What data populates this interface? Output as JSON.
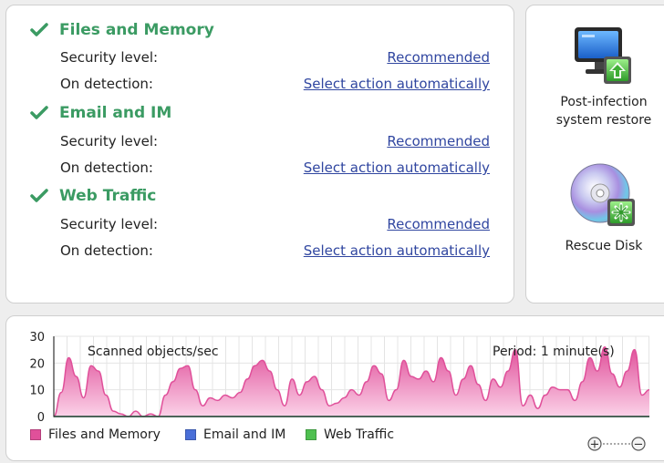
{
  "settings": {
    "sections": [
      {
        "title": "Files and Memory",
        "security_label": "Security level:",
        "security_value": "Recommended",
        "detection_label": "On detection:",
        "detection_value": "Select action automatically"
      },
      {
        "title": "Email and IM",
        "security_label": "Security level:",
        "security_value": "Recommended",
        "detection_label": "On detection:",
        "detection_value": "Select action automatically"
      },
      {
        "title": "Web Traffic",
        "security_label": "Security level:",
        "security_value": "Recommended",
        "detection_label": "On detection:",
        "detection_value": "Select action automatically"
      }
    ]
  },
  "tools": {
    "restore_line1": "Post-infection",
    "restore_line2": "system restore",
    "rescue_disk": "Rescue Disk"
  },
  "chart": {
    "title": "Scanned objects/sec",
    "period": "Period: 1 minute(s)",
    "zoom_in": "+",
    "zoom_out": "−"
  },
  "colors": {
    "accent_green": "#3b9b63",
    "link_blue": "#3046a0",
    "files_memory": "#e0509a",
    "email_im": "#4a6fd8",
    "web_traffic": "#4fc050"
  },
  "chart_data": {
    "type": "area",
    "ylim": [
      0,
      30
    ],
    "yticks": [
      0,
      10,
      20,
      30
    ],
    "legend": [
      "Files and Memory",
      "Email and IM",
      "Web Traffic"
    ],
    "series": [
      {
        "name": "Files and Memory",
        "values": [
          0,
          9,
          22,
          15,
          7,
          19,
          17,
          8,
          2,
          1,
          0,
          2,
          0,
          1,
          0,
          8,
          13,
          18,
          19,
          10,
          4,
          7,
          6,
          8,
          7,
          9,
          14,
          19,
          21,
          17,
          10,
          4,
          14,
          8,
          13,
          15,
          10,
          4,
          5,
          7,
          10,
          8,
          13,
          19,
          16,
          6,
          10,
          21,
          15,
          14,
          17,
          13,
          22,
          17,
          8,
          14,
          19,
          12,
          6,
          14,
          11,
          17,
          25,
          4,
          8,
          3,
          8,
          11,
          10,
          10,
          6,
          13,
          22,
          17,
          26,
          16,
          11,
          17,
          25,
          8,
          10
        ]
      },
      {
        "name": "Email and IM",
        "values": [
          0,
          0,
          0,
          0,
          0,
          0,
          0,
          0,
          0,
          0,
          0,
          0,
          0,
          0,
          0,
          0,
          0,
          0,
          0,
          0,
          0,
          0,
          0,
          0,
          0,
          0,
          0,
          0,
          0,
          0,
          0,
          0,
          0,
          0,
          0,
          0,
          0,
          0,
          0,
          0,
          0,
          0,
          0,
          0,
          0,
          0,
          0,
          0,
          0,
          0,
          0,
          0,
          0,
          0,
          0,
          0,
          0,
          0,
          0,
          0,
          0,
          0,
          0,
          0,
          0,
          0,
          0,
          0,
          0,
          0,
          0,
          0,
          0,
          0,
          0,
          0,
          0,
          0,
          0,
          0,
          0
        ]
      },
      {
        "name": "Web Traffic",
        "values": [
          0,
          0,
          0,
          0,
          0,
          0,
          0,
          0,
          0,
          0,
          0,
          0,
          0,
          0,
          0,
          0,
          0,
          0,
          0,
          0,
          0,
          0,
          0,
          0,
          0,
          0,
          0,
          0,
          0,
          0,
          0,
          0,
          0,
          0,
          0,
          0,
          0,
          0,
          0,
          0,
          0,
          0,
          0,
          0,
          0,
          0,
          0,
          0,
          0,
          0,
          0,
          0,
          0,
          0,
          0,
          0,
          0,
          0,
          0,
          0,
          0,
          0,
          0,
          0,
          0,
          0,
          0,
          0,
          0,
          0,
          0,
          0,
          0,
          0,
          0,
          0,
          0,
          0,
          0,
          0,
          0
        ]
      }
    ]
  }
}
